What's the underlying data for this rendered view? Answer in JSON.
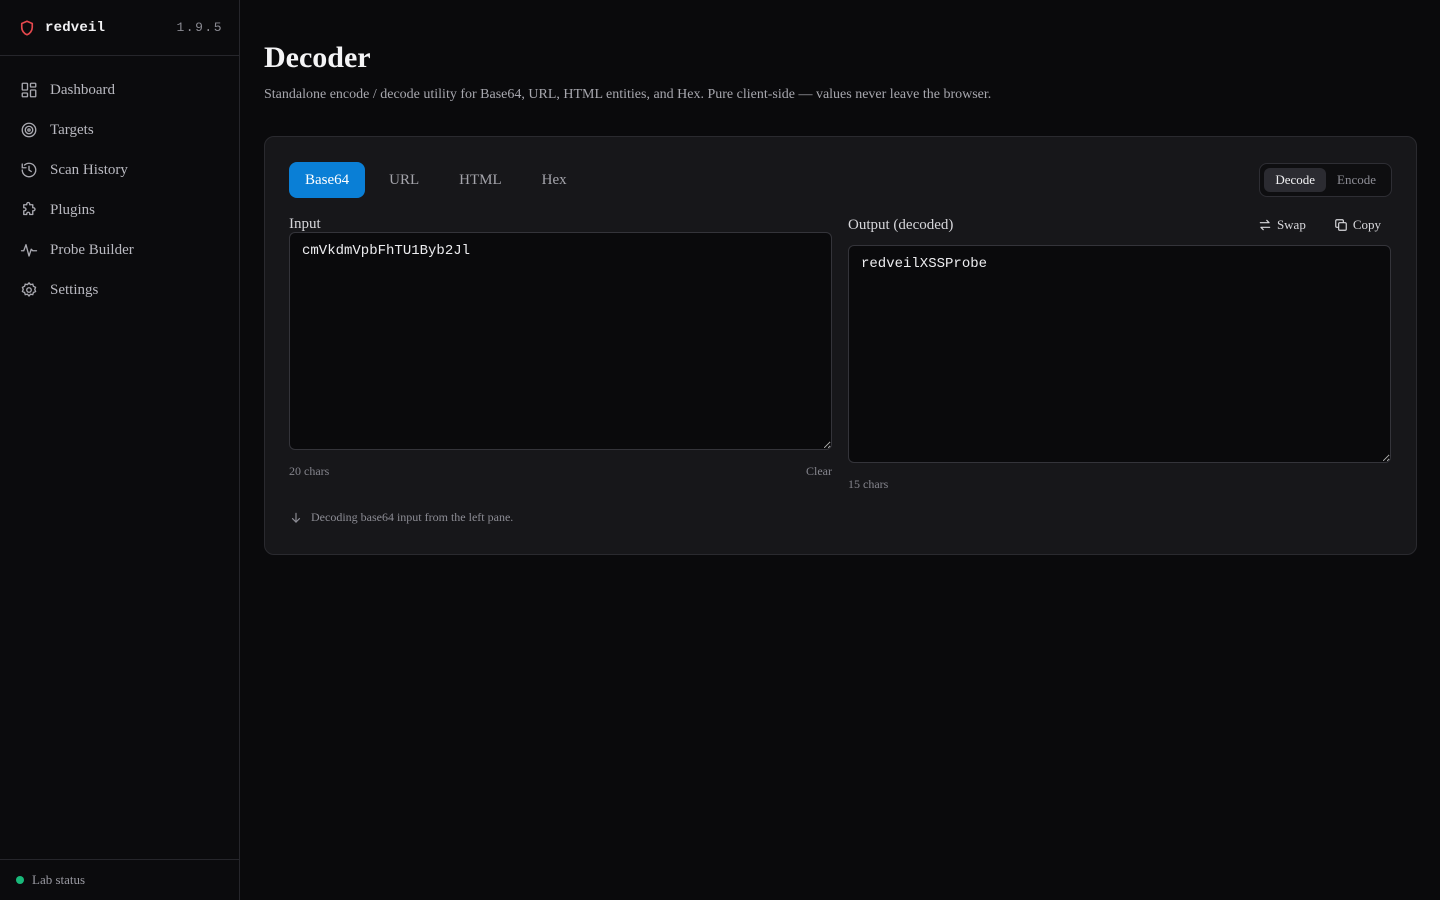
{
  "brand": {
    "name": "redveil",
    "version": "1.9.5",
    "logo_icon": "shield-icon",
    "accent": "#e5484d"
  },
  "sidebar": {
    "items": [
      {
        "label": "Dashboard",
        "icon": "grid-icon"
      },
      {
        "label": "Targets",
        "icon": "target-icon"
      },
      {
        "label": "Scan History",
        "icon": "history-icon"
      },
      {
        "label": "Plugins",
        "icon": "puzzle-icon"
      },
      {
        "label": "Probe Builder",
        "icon": "wave-icon"
      },
      {
        "label": "Settings",
        "icon": "gear-icon"
      }
    ],
    "status_label": "Lab status",
    "status_color": "#19b97a"
  },
  "page": {
    "title": "Decoder",
    "subtitle": "Standalone encode / decode utility for Base64, URL, HTML entities, and Hex. Pure client-side — values never leave the browser."
  },
  "decoder": {
    "tabs": [
      "Base64",
      "URL",
      "HTML",
      "Hex"
    ],
    "active_tab": "Base64",
    "modes": [
      "Decode",
      "Encode"
    ],
    "active_mode": "Decode",
    "input": {
      "label": "Input",
      "value": "cmVkdmVpbFhTU1Byb2Jl",
      "count": "20 chars",
      "clear_label": "Clear"
    },
    "output": {
      "label": "Output (decoded)",
      "value": "redveilXSSProbe",
      "count": "15 chars",
      "swap_label": "Swap",
      "copy_label": "Copy"
    },
    "hint": "Decoding base64 input from the left pane.",
    "accent": "#0a7fd6"
  }
}
